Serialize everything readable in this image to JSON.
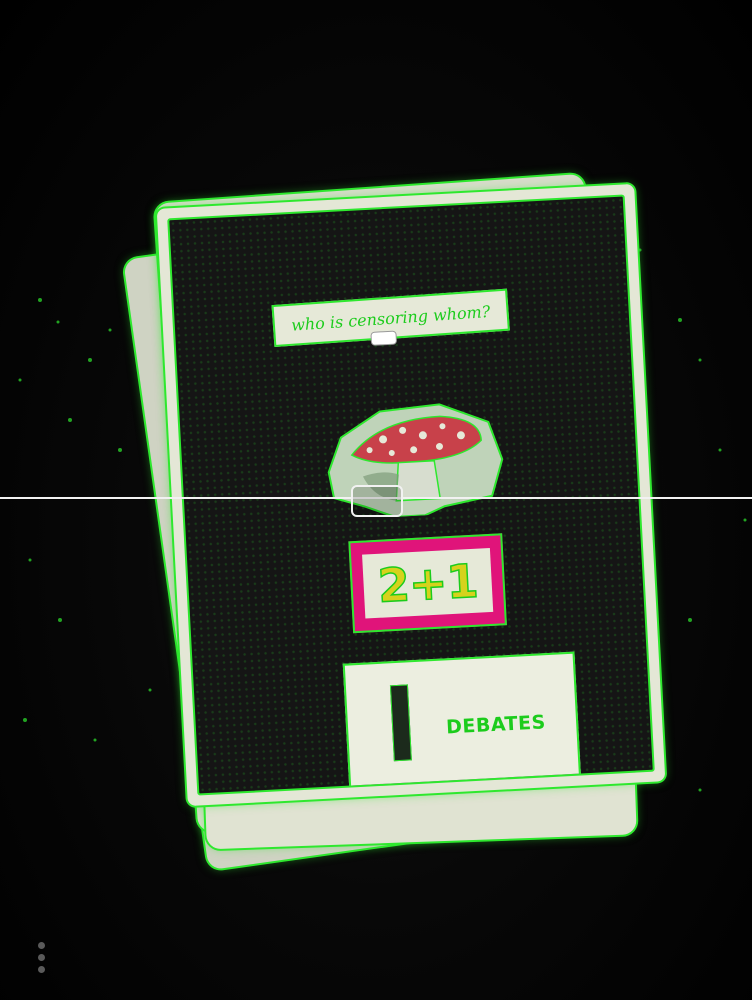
{
  "card": {
    "question": "who is censoring whom?",
    "number": "2+1",
    "label": "DEBATES"
  },
  "colors": {
    "outline": "#2ee82e",
    "number_frame": "#e0147a",
    "number_text": "#d6d21c",
    "mushroom_cap": "#c8414a",
    "background": "#050505"
  },
  "icons": {
    "focus": "focus-bracket-icon",
    "menu": "vertical-dots-icon"
  }
}
